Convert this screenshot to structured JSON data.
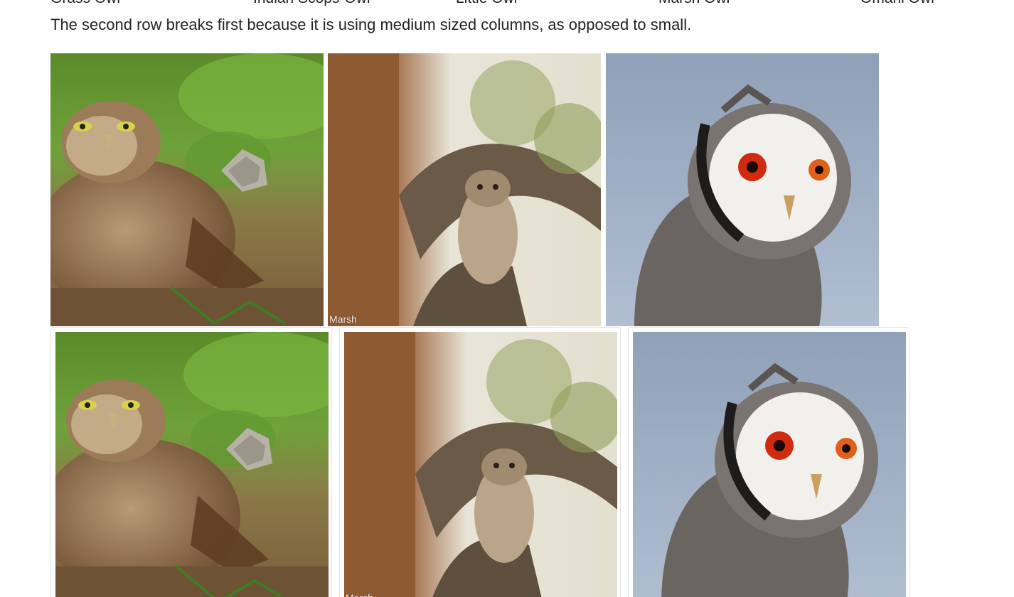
{
  "owl_names": [
    "Grass Owl",
    "Indian Scops-Owl",
    "Little Owl",
    "Marsh Owl",
    "Omani Owl"
  ],
  "lead_text": "The second row breaks first because it is using medium sized columns, as opposed to small.",
  "images": {
    "burrowing_owl": {
      "alt": "Burrowing owl on grass and gravel"
    },
    "eagle_owl_tree": {
      "alt": "Owl perched in a tree",
      "watermark": "Marsh"
    },
    "white_faced_owl": {
      "alt": "White-faced scops owl with orange eyes"
    }
  },
  "colors": {
    "text": "#212529",
    "thumbnail_border": "#dee2e6",
    "background": "#ffffff"
  }
}
